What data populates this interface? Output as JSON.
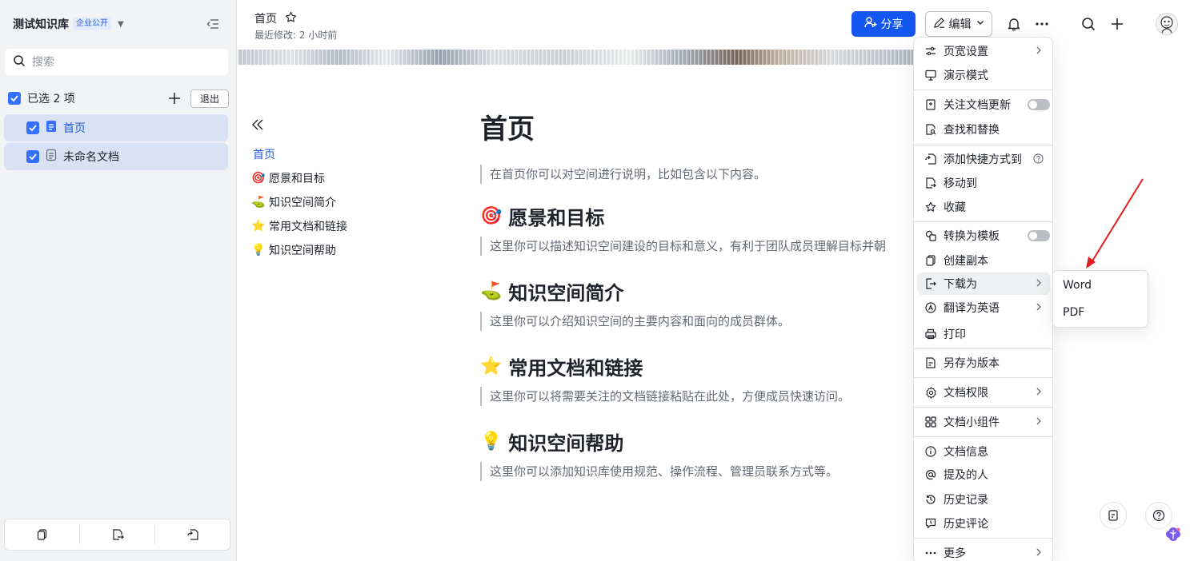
{
  "sidebar": {
    "kb_title": "测试知识库",
    "kb_badge": "企业公开",
    "search_placeholder": "搜索",
    "selection_text": "已选 2 项",
    "exit_label": "退出",
    "items": [
      {
        "label": "首页",
        "active": true
      },
      {
        "label": "未命名文档",
        "active": false
      }
    ]
  },
  "topbar": {
    "doc_title": "首页",
    "last_modified": "最近修改: 2 小时前",
    "share_label": "分享",
    "edit_label": "编辑"
  },
  "outline": {
    "items": [
      {
        "label": "首页",
        "emoji": ""
      },
      {
        "label": "愿景和目标",
        "emoji": "🎯"
      },
      {
        "label": "知识空间简介",
        "emoji": "⛳"
      },
      {
        "label": "常用文档和链接",
        "emoji": "⭐"
      },
      {
        "label": "知识空间帮助",
        "emoji": "💡"
      }
    ]
  },
  "content": {
    "title": "首页",
    "intro": "在首页你可以对空间进行说明，比如包含以下内容。",
    "sections": [
      {
        "emoji": "🎯",
        "heading": "愿景和目标",
        "text": "这里你可以描述知识空间建设的目标和意义，有利于团队成员理解目标并朝"
      },
      {
        "emoji": "⛳",
        "heading": "知识空间简介",
        "text": "这里你可以介绍知识空间的主要内容和面向的成员群体。"
      },
      {
        "emoji": "⭐",
        "heading": "常用文档和链接",
        "text": "这里你可以将需要关注的文档链接粘贴在此处，方便成员快速访问。"
      },
      {
        "emoji": "💡",
        "heading": "知识空间帮助",
        "text": "这里你可以添加知识库使用规范、操作流程、管理员联系方式等。"
      }
    ]
  },
  "menu": {
    "page_width": "页宽设置",
    "presentation": "演示模式",
    "follow_updates": "关注文档更新",
    "find_replace": "查找和替换",
    "add_shortcut": "添加快捷方式到",
    "move_to": "移动到",
    "favorite": "收藏",
    "convert_template": "转换为模板",
    "create_copy": "创建副本",
    "download_as": "下载为",
    "translate": "翻译为英语",
    "print": "打印",
    "save_version": "另存为版本",
    "permissions": "文档权限",
    "widgets": "文档小组件",
    "doc_info": "文档信息",
    "mentioned": "提及的人",
    "history": "历史记录",
    "history_comments": "历史评论",
    "more": "更多"
  },
  "submenu": {
    "word": "Word",
    "pdf": "PDF"
  },
  "colors": {
    "accent": "#1456f0",
    "selected_bg": "#d9e2f5",
    "annotation_arrow": "#e02020"
  }
}
